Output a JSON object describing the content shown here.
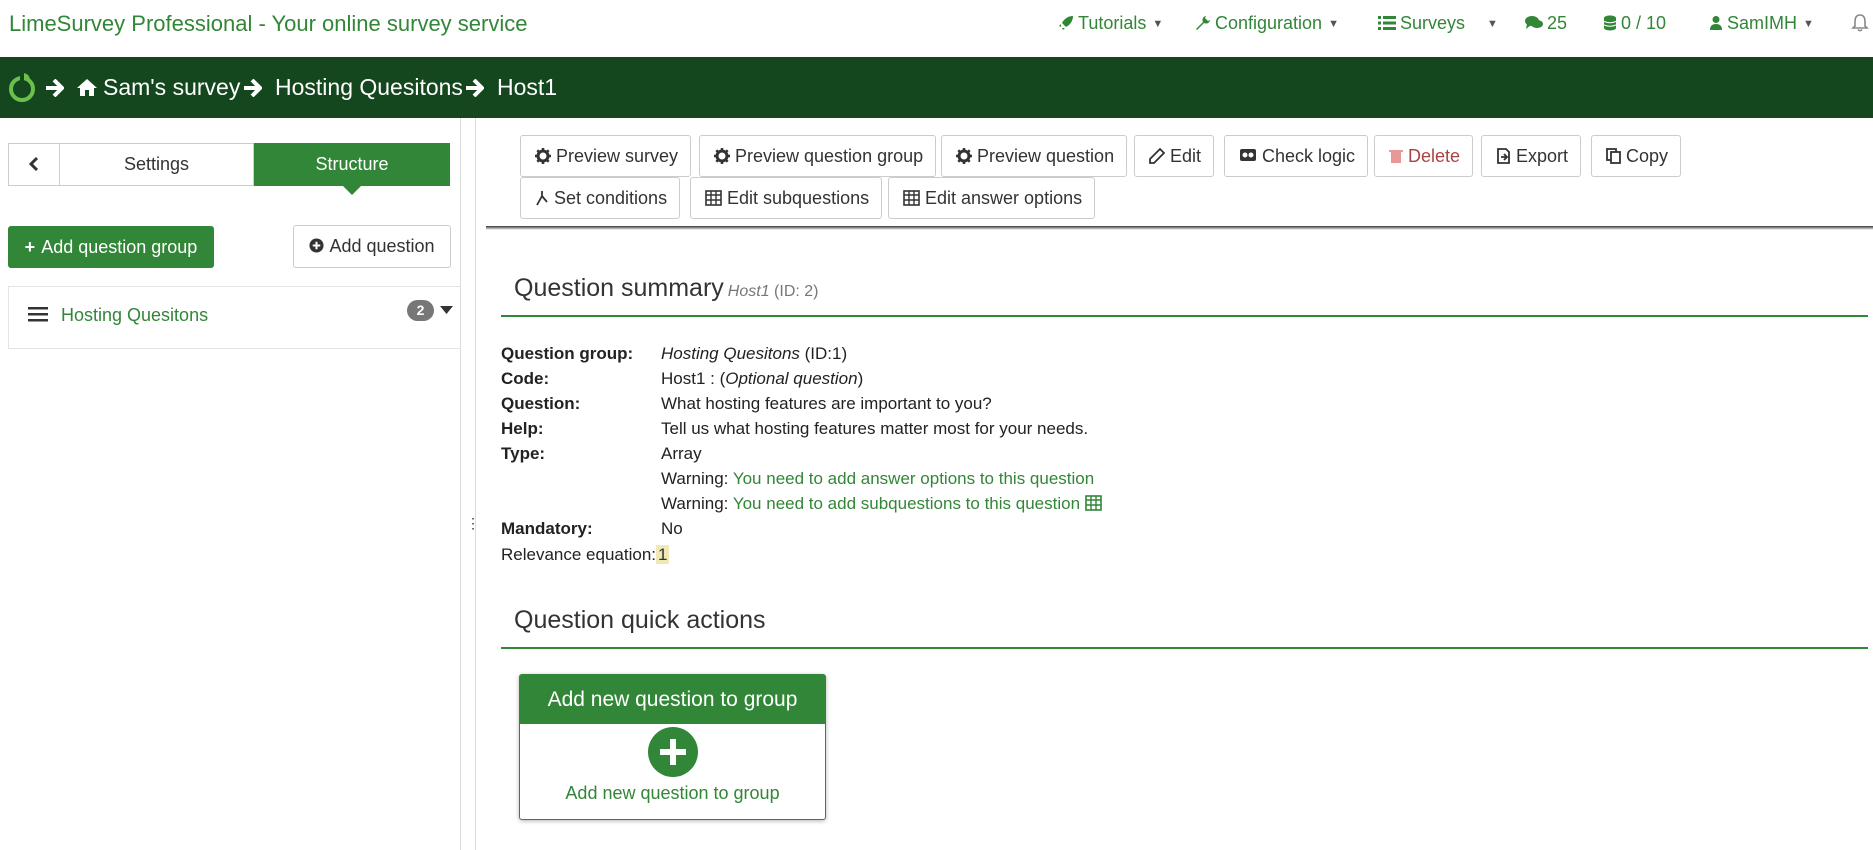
{
  "topbar": {
    "brand": "LimeSurvey Professional - Your online survey service",
    "tutorials": "Tutorials",
    "configuration": "Configuration",
    "surveys": "Surveys",
    "comments_count": "25",
    "storage": "0 / 10",
    "user": "SamIMH"
  },
  "breadcrumb": {
    "survey": "Sam's survey",
    "group": "Hosting Quesitons",
    "question": "Host1"
  },
  "sidebar": {
    "tab_settings": "Settings",
    "tab_structure": "Structure",
    "add_group": "Add question group",
    "add_question": "Add question",
    "group_name": "Hosting Quesitons",
    "group_count": "2"
  },
  "toolbar": {
    "preview_survey": "Preview survey",
    "preview_group": "Preview question group",
    "preview_question": "Preview question",
    "edit": "Edit",
    "check_logic": "Check logic",
    "delete": "Delete",
    "export": "Export",
    "copy": "Copy",
    "set_conditions": "Set conditions",
    "edit_subquestions": "Edit subquestions",
    "edit_answer_options": "Edit answer options"
  },
  "summary": {
    "title": "Question summary",
    "code_small": "Host1",
    "id_small": "(ID: 2)",
    "group_label": "Question group:",
    "group_value": "Hosting Quesitons",
    "group_id": "(ID:1)",
    "code_label": "Code:",
    "code_value": "Host1 : (",
    "code_optional": "Optional question",
    "code_close": ")",
    "question_label": "Question:",
    "question_value": "What hosting features are important to you?",
    "help_label": "Help:",
    "help_value": "Tell us what hosting features matter most for your needs.",
    "type_label": "Type:",
    "type_value": "Array",
    "warning_prefix": "Warning:",
    "warning_answers": "You need to add answer options to this question",
    "warning_subquestions": "You need to add subquestions to this question",
    "mandatory_label": "Mandatory:",
    "mandatory_value": "No",
    "relevance_label": "Relevance equation:",
    "relevance_value": "1"
  },
  "quick_actions": {
    "title": "Question quick actions",
    "card_header": "Add new question to group",
    "card_footer": "Add new question to group"
  },
  "colors": {
    "brand_green": "#328637",
    "dark_green": "#14471e"
  }
}
